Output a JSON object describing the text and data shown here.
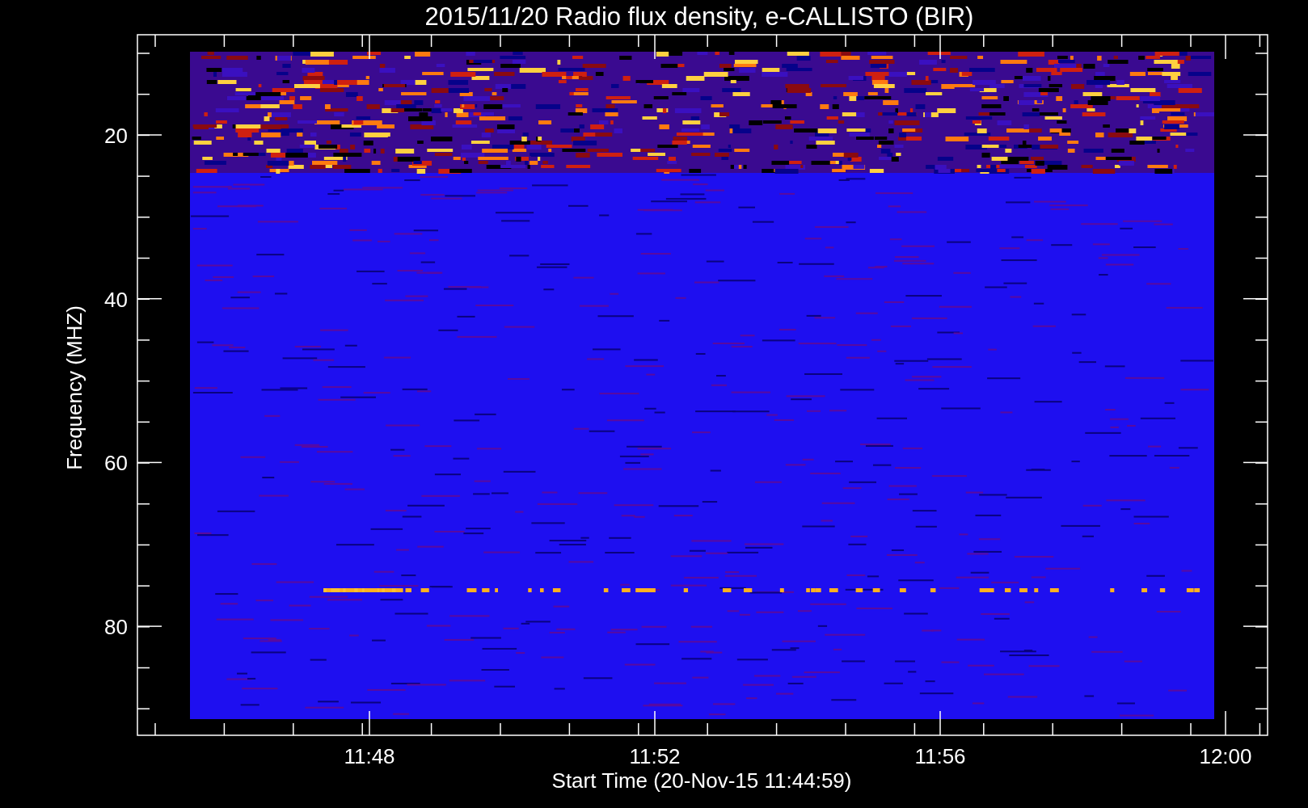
{
  "title": "2015/11/20  Radio flux density, e-CALLISTO (BIR)",
  "y_axis": {
    "label": "Frequency (MHZ)",
    "ticks": [
      "20",
      "40",
      "60",
      "80"
    ]
  },
  "x_axis": {
    "label": "Start Time (20-Nov-15 11:44:59)",
    "ticks": [
      "11:48",
      "11:52",
      "11:56",
      "12:00"
    ]
  }
}
